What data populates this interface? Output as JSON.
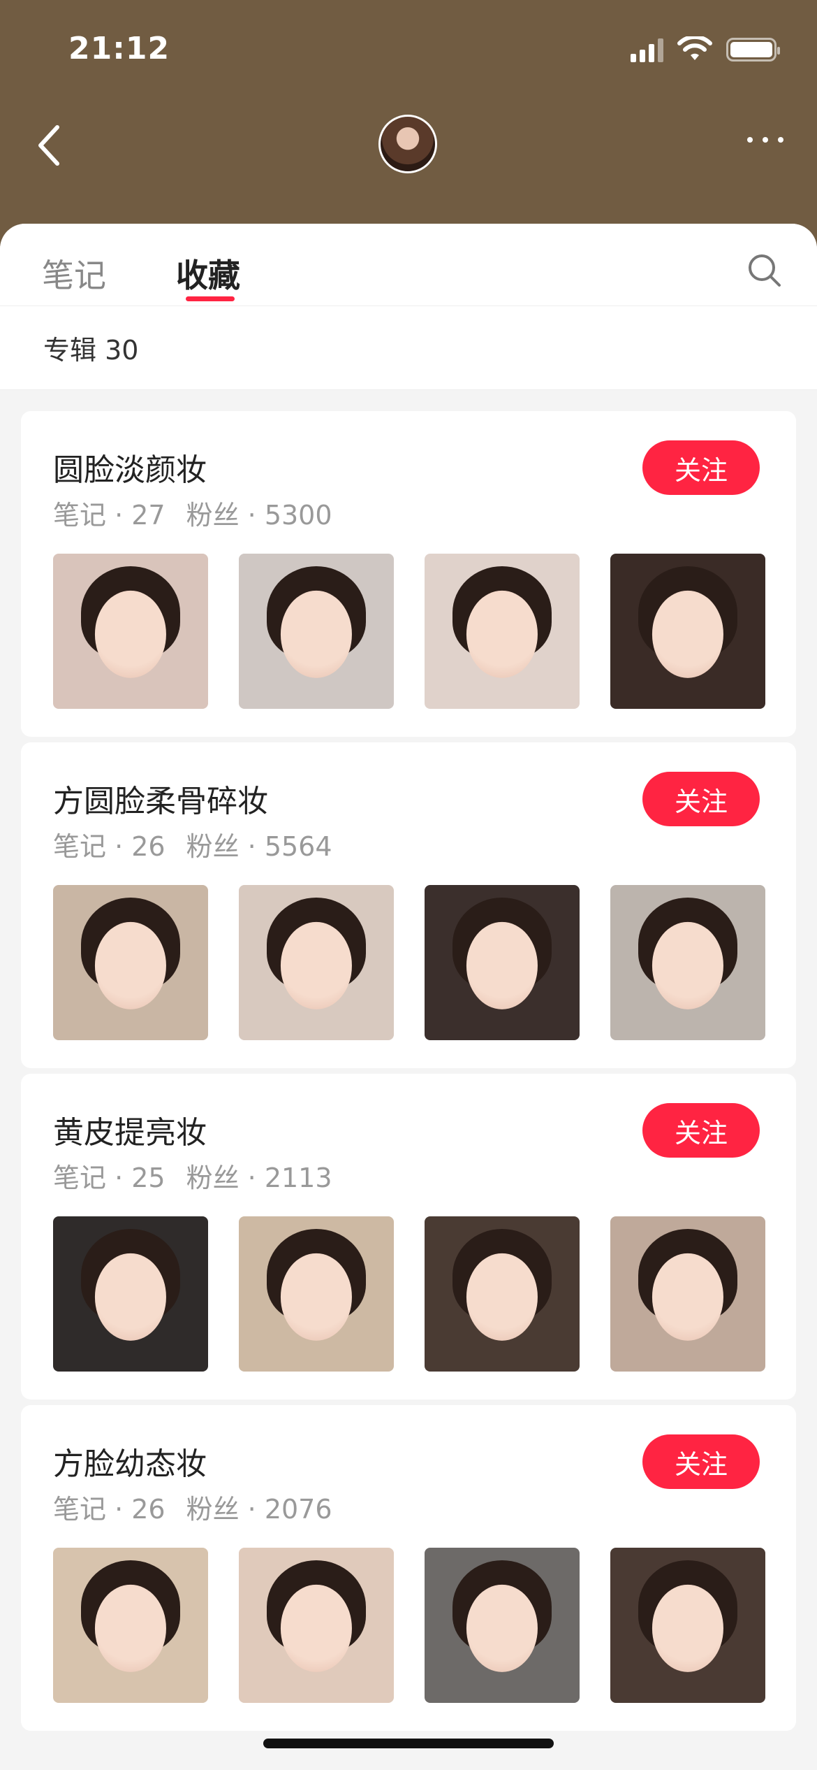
{
  "status_bar": {
    "time": "21:12"
  },
  "tabs": [
    {
      "label": "笔记",
      "active": false
    },
    {
      "label": "收藏",
      "active": true
    }
  ],
  "album_count_label": "专辑 30",
  "albums": [
    {
      "title": "圆脸淡颜妆",
      "notes_label": "笔记 · 27",
      "fans_label": "粉丝 · 5300",
      "follow_label": "关注",
      "thumbs": [
        "#d9c4bb",
        "#cfc7c3",
        "#e0d2cb",
        "#3a2b26"
      ]
    },
    {
      "title": "方圆脸柔骨碎妆",
      "notes_label": "笔记 · 26",
      "fans_label": "粉丝 · 5564",
      "follow_label": "关注",
      "thumbs": [
        "#c9b6a4",
        "#d8c9bf",
        "#3b2f2c",
        "#bcb4ad"
      ]
    },
    {
      "title": "黄皮提亮妆",
      "notes_label": "笔记 · 25",
      "fans_label": "粉丝 · 2113",
      "follow_label": "关注",
      "thumbs": [
        "#2f2b2a",
        "#cdb9a3",
        "#4a3b33",
        "#bfa99a"
      ]
    },
    {
      "title": "方脸幼态妆",
      "notes_label": "笔记 · 26",
      "fans_label": "粉丝 · 2076",
      "follow_label": "关注",
      "thumbs": [
        "#d7c3ad",
        "#e0cabb",
        "#6d6a68",
        "#4a3a33"
      ]
    }
  ],
  "colors": {
    "header": "#715c42",
    "accent": "#ff2442"
  }
}
